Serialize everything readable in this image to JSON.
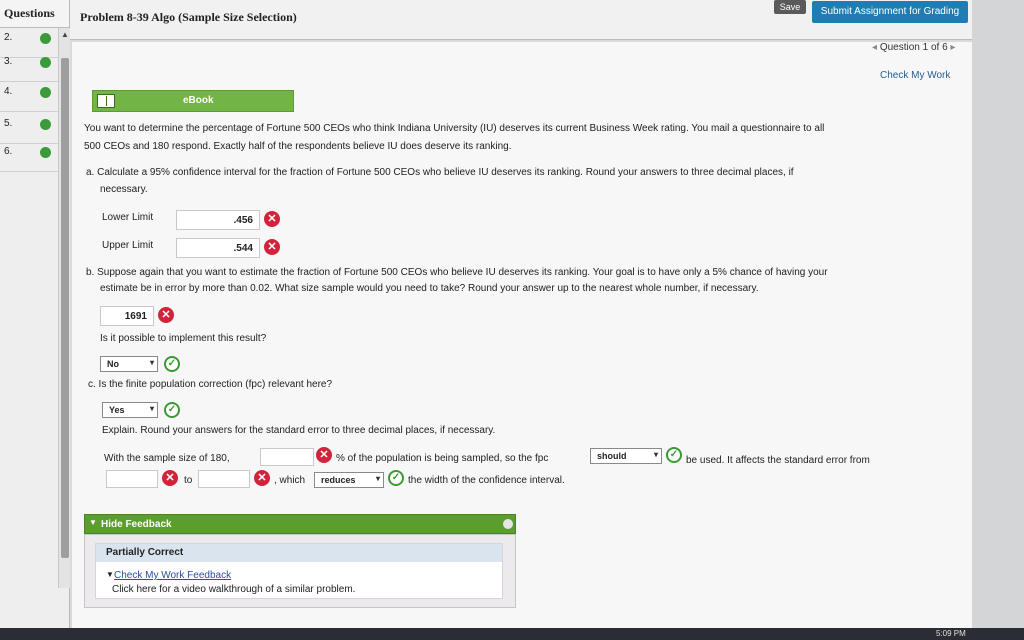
{
  "sidebar": {
    "header": "Questions",
    "items": [
      {
        "label": "2."
      },
      {
        "label": "3."
      },
      {
        "label": "4."
      },
      {
        "label": "5."
      },
      {
        "label": "6."
      }
    ]
  },
  "header": {
    "problem_title": "Problem 8-39 Algo (Sample Size Selection)",
    "save_label": "Save",
    "submit_label": "Submit Assignment for Grading"
  },
  "nav": {
    "question_counter": "Question 1 of 6",
    "check_my_work": "Check My Work"
  },
  "ebook": {
    "label": "eBook"
  },
  "question": {
    "intro_line1": "You want to determine the percentage of Fortune 500 CEOs who think Indiana University (IU) deserves its current Business Week rating. You mail a questionnaire to all",
    "intro_line2": "500 CEOs and 180 respond. Exactly half of the respondents believe IU does deserve its ranking.",
    "part_a_line1": "a. Calculate a 95% confidence interval for the fraction of Fortune 500 CEOs who believe IU deserves its ranking. Round your answers to three decimal places, if",
    "part_a_line2": "necessary.",
    "lower_label": "Lower Limit",
    "lower_value": ".456",
    "upper_label": "Upper Limit",
    "upper_value": ".544",
    "part_b_line1": "b. Suppose again that you want to estimate the fraction of Fortune 500 CEOs who believe IU deserves its ranking. Your goal is to have only a 5% chance of having your",
    "part_b_line2": "estimate be in error by more than 0.02. What size sample would you need to take? Round your answer up to the nearest whole number, if necessary.",
    "sample_value": "1691",
    "possible_q": "Is it possible to implement this result?",
    "possible_sel": "No",
    "part_c": "c. Is the finite population correction (fpc) relevant here?",
    "fpc_sel": "Yes",
    "explain": "Explain. Round your answers for the standard error to three decimal places, if necessary.",
    "sent_prefix": "With the sample size of 180,",
    "sent_mid": "% of the population is being sampled, so the fpc",
    "sent_should": "should",
    "sent_after": "be used. It affects the standard error from",
    "sent_to": "to",
    "sent_which": ", which",
    "sent_reduces": "reduces",
    "sent_end": "the width of the confidence interval."
  },
  "feedback": {
    "toggle_label": "Hide Feedback",
    "status": "Partially Correct",
    "link": "Check My Work Feedback",
    "video": "Click here for a video walkthrough of a similar problem."
  },
  "system": {
    "clock": "5:09 PM"
  }
}
